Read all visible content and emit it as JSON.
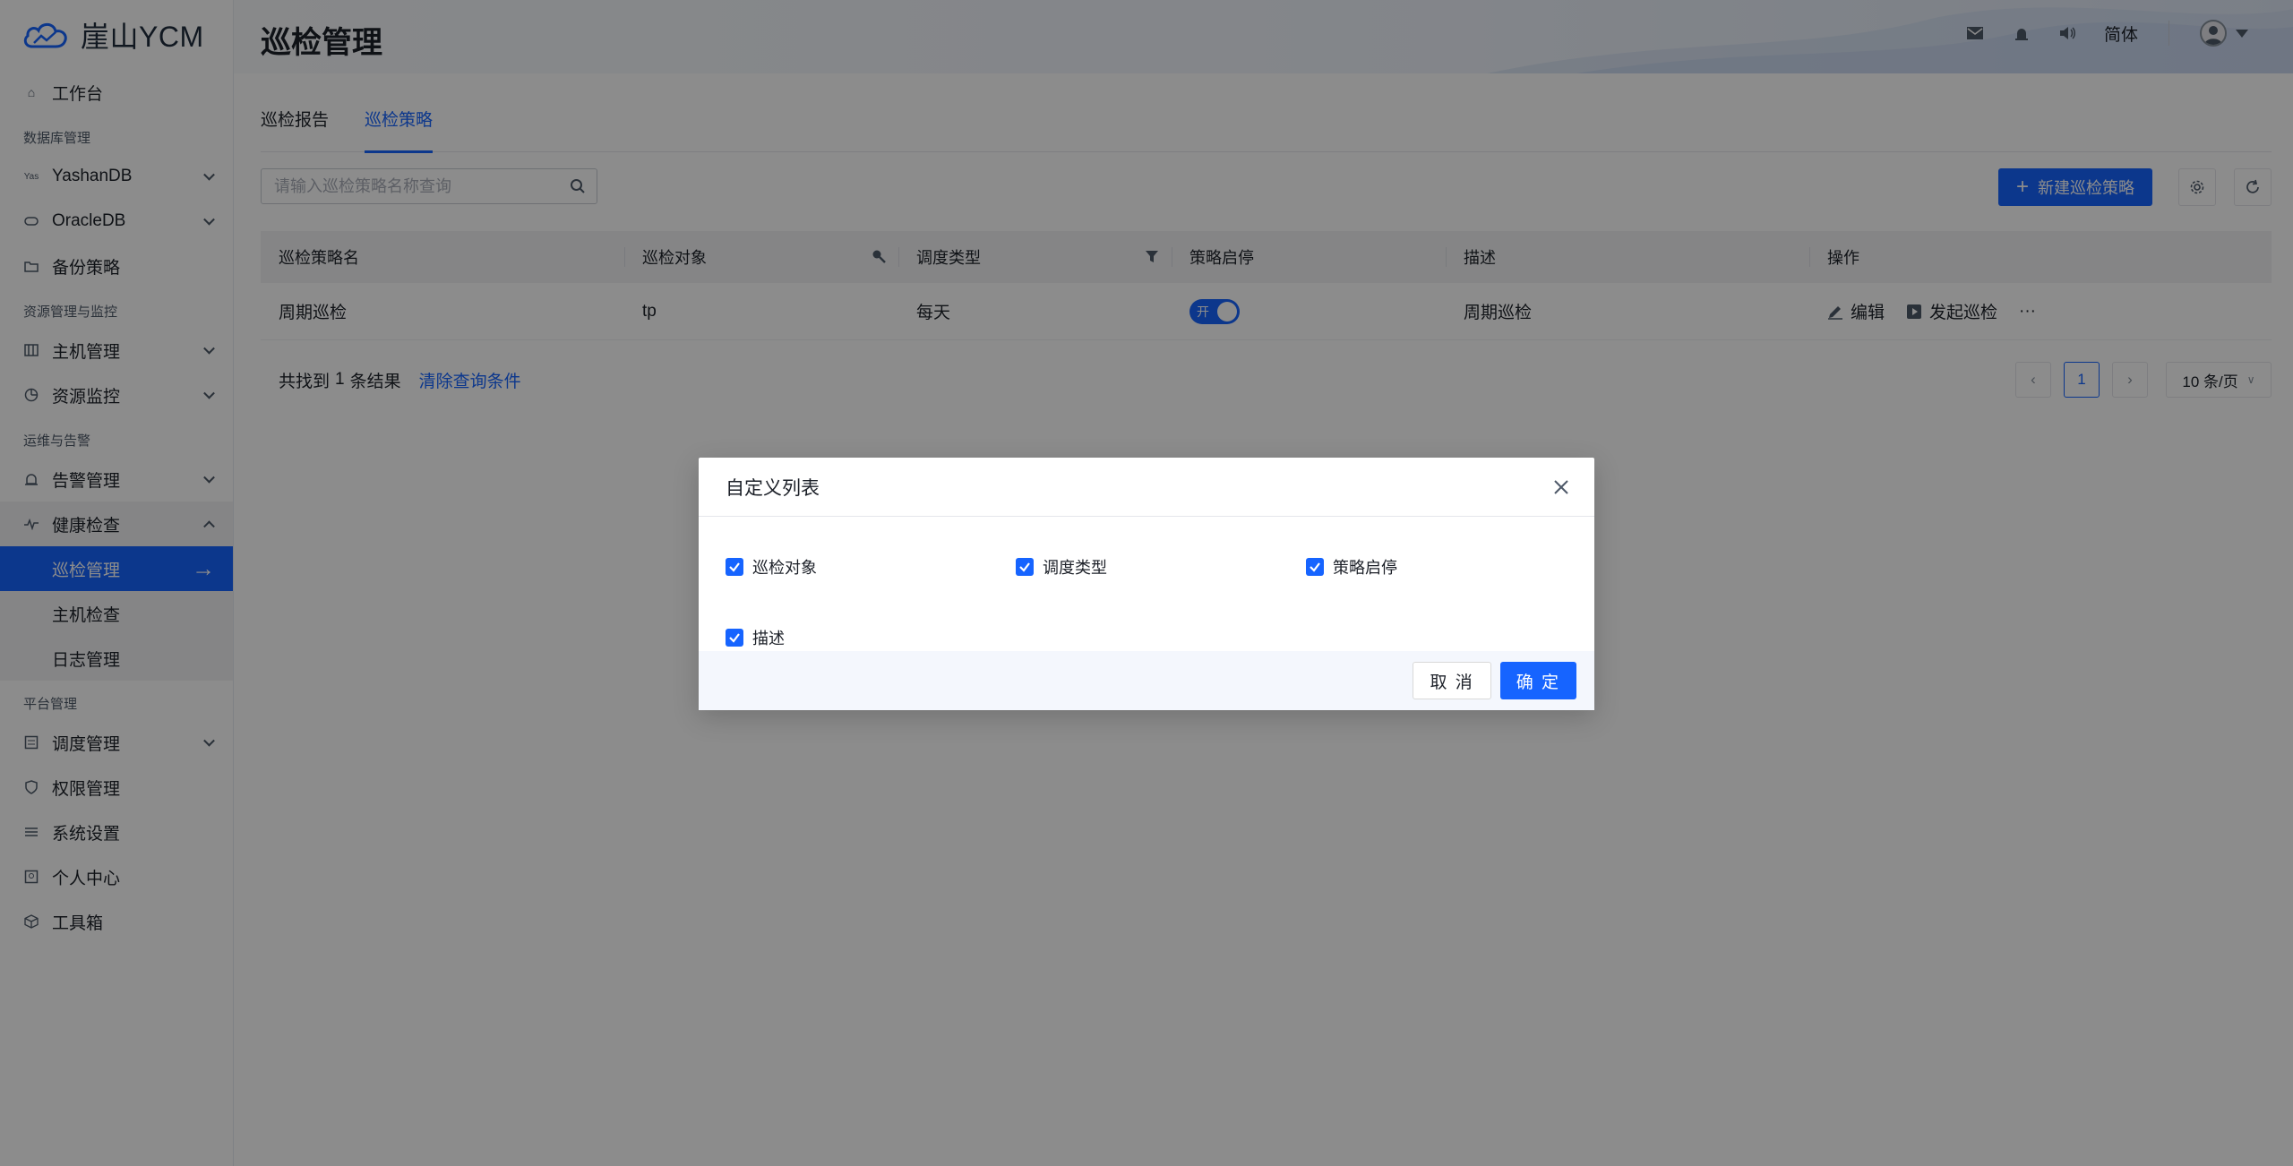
{
  "app": {
    "logo_text": "崖山YCM"
  },
  "header": {
    "page_title": "巡检管理",
    "language": "简体"
  },
  "sidebar": {
    "workbench": "工作台",
    "groups": {
      "db": "数据库管理",
      "resource": "资源管理与监控",
      "ops": "运维与告警",
      "platform": "平台管理"
    },
    "items": {
      "yashandb": "YashanDB",
      "oracledb": "OracleDB",
      "backup": "备份策略",
      "host": "主机管理",
      "monitor": "资源监控",
      "alarm": "告警管理",
      "health": "健康检查",
      "inspection": "巡检管理",
      "host_check": "主机检查",
      "log": "日志管理",
      "schedule": "调度管理",
      "permission": "权限管理",
      "system": "系统设置",
      "personal": "个人中心",
      "toolbox": "工具箱"
    }
  },
  "main": {
    "tabs": [
      "巡检报告",
      "巡检策略"
    ],
    "active_tab": 1,
    "search_placeholder": "请输入巡检策略名称查询",
    "new_button": "新建巡检策略",
    "table": {
      "headers": [
        "巡检策略名",
        "巡检对象",
        "调度类型",
        "策略启停",
        "描述",
        "操作"
      ],
      "rows": [
        {
          "name": "周期巡检",
          "target": "tp",
          "schedule": "每天",
          "switch_label": "开",
          "enabled": true,
          "desc": "周期巡检",
          "edit": "编辑",
          "run": "发起巡检",
          "more": "···"
        }
      ]
    },
    "footer": {
      "found_prefix": "共找到",
      "count": "1",
      "found_suffix": "条结果",
      "clear": "清除查询条件",
      "current_page": "1",
      "page_size": "10 条/页"
    }
  },
  "modal": {
    "title": "自定义列表",
    "options": [
      {
        "label": "巡检对象",
        "checked": true
      },
      {
        "label": "调度类型",
        "checked": true
      },
      {
        "label": "策略启停",
        "checked": true
      },
      {
        "label": "描述",
        "checked": true
      }
    ],
    "cancel": "取 消",
    "ok": "确 定"
  },
  "colors": {
    "primary": "#1664ff",
    "mask": "rgba(0,0,0,0.45)"
  }
}
